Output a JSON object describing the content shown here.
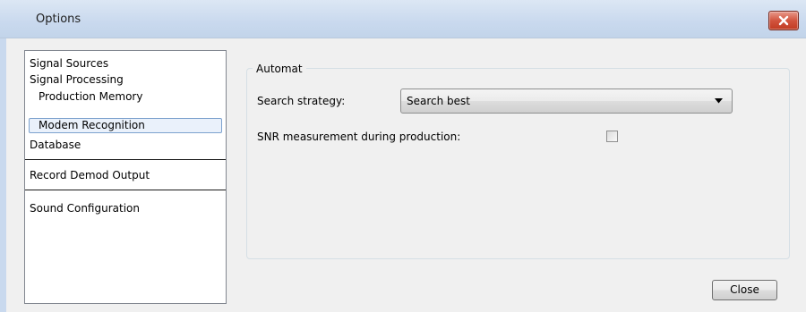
{
  "window": {
    "title": "Options"
  },
  "sidebar": {
    "items": [
      {
        "label": "Signal Sources",
        "level": 0,
        "selected": false
      },
      {
        "label": "Signal Processing",
        "level": 0,
        "selected": false
      },
      {
        "label": "Production Memory",
        "level": 1,
        "selected": false
      },
      {
        "label": "Modem Recognition",
        "level": 1,
        "selected": true
      },
      {
        "label": "Database",
        "level": 0,
        "selected": false
      },
      {
        "label": "Record Demod Output",
        "level": 0,
        "selected": false
      },
      {
        "label": "Sound Configuration",
        "level": 0,
        "selected": false
      }
    ]
  },
  "panel": {
    "group_title": "Automat",
    "search_strategy_label": "Search strategy:",
    "search_strategy_value": "Search best",
    "snr_label": "SNR measurement during production:",
    "snr_checked": false
  },
  "footer": {
    "close_label": "Close"
  },
  "colors": {
    "titlebar": "#c9d9ee",
    "close_button": "#c13b22",
    "selection_border": "#7da2ce",
    "selection_fill": "#eaf1fb"
  },
  "icons": {
    "close": "close-icon",
    "dropdown": "chevron-down-icon"
  }
}
